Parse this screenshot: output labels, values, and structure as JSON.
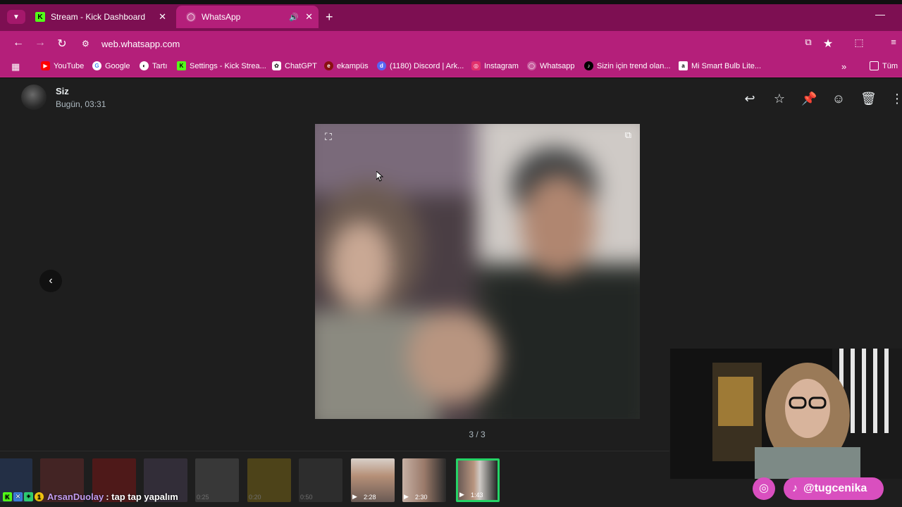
{
  "browser": {
    "tabs": [
      {
        "label": "Stream - Kick Dashboard",
        "icon": "kick-icon"
      },
      {
        "label": "WhatsApp",
        "icon": "whatsapp-icon",
        "active": true
      }
    ],
    "url": "web.whatsapp.com",
    "bookmarks": [
      {
        "label": "YouTube",
        "icon": "youtube-icon"
      },
      {
        "label": "Google",
        "icon": "google-icon"
      },
      {
        "label": "Tartı",
        "icon": "globe-icon"
      },
      {
        "label": "Settings - Kick Strea...",
        "icon": "kick-icon"
      },
      {
        "label": "ChatGPT",
        "icon": "chatgpt-icon"
      },
      {
        "label": "ekampüs",
        "icon": "ekampus-icon"
      },
      {
        "label": "(1180) Discord | Ark...",
        "icon": "discord-icon"
      },
      {
        "label": "Instagram",
        "icon": "instagram-icon"
      },
      {
        "label": "Whatsapp",
        "icon": "whatsapp-icon"
      },
      {
        "label": "Sizin için trend olan...",
        "icon": "tiktok-icon"
      },
      {
        "label": "Mi Smart Bulb Lite...",
        "icon": "amazon-icon"
      },
      {
        "label": "Tüm",
        "icon": "folder-icon"
      }
    ]
  },
  "viewer": {
    "sender_name": "Siz",
    "sender_time": "Bugün, 03:31",
    "counter": "3 / 3",
    "thumbnails": [
      {
        "duration": ""
      },
      {
        "duration": ""
      },
      {
        "duration": ""
      },
      {
        "duration": ""
      },
      {
        "duration": "0:25"
      },
      {
        "duration": "0:20"
      },
      {
        "duration": "0:50"
      },
      {
        "duration": "2:28"
      },
      {
        "duration": "2:30"
      },
      {
        "duration": "1:43"
      }
    ]
  },
  "stream_chat": {
    "user": "ArsanDuolay",
    "message": ": tap tap yapalım"
  },
  "social": {
    "tiktok_handle": "@tugcenika"
  },
  "colors": {
    "browser_accent": "#b41f7a",
    "whatsapp_green": "#25d366",
    "social_pill": "#d94fbf"
  }
}
